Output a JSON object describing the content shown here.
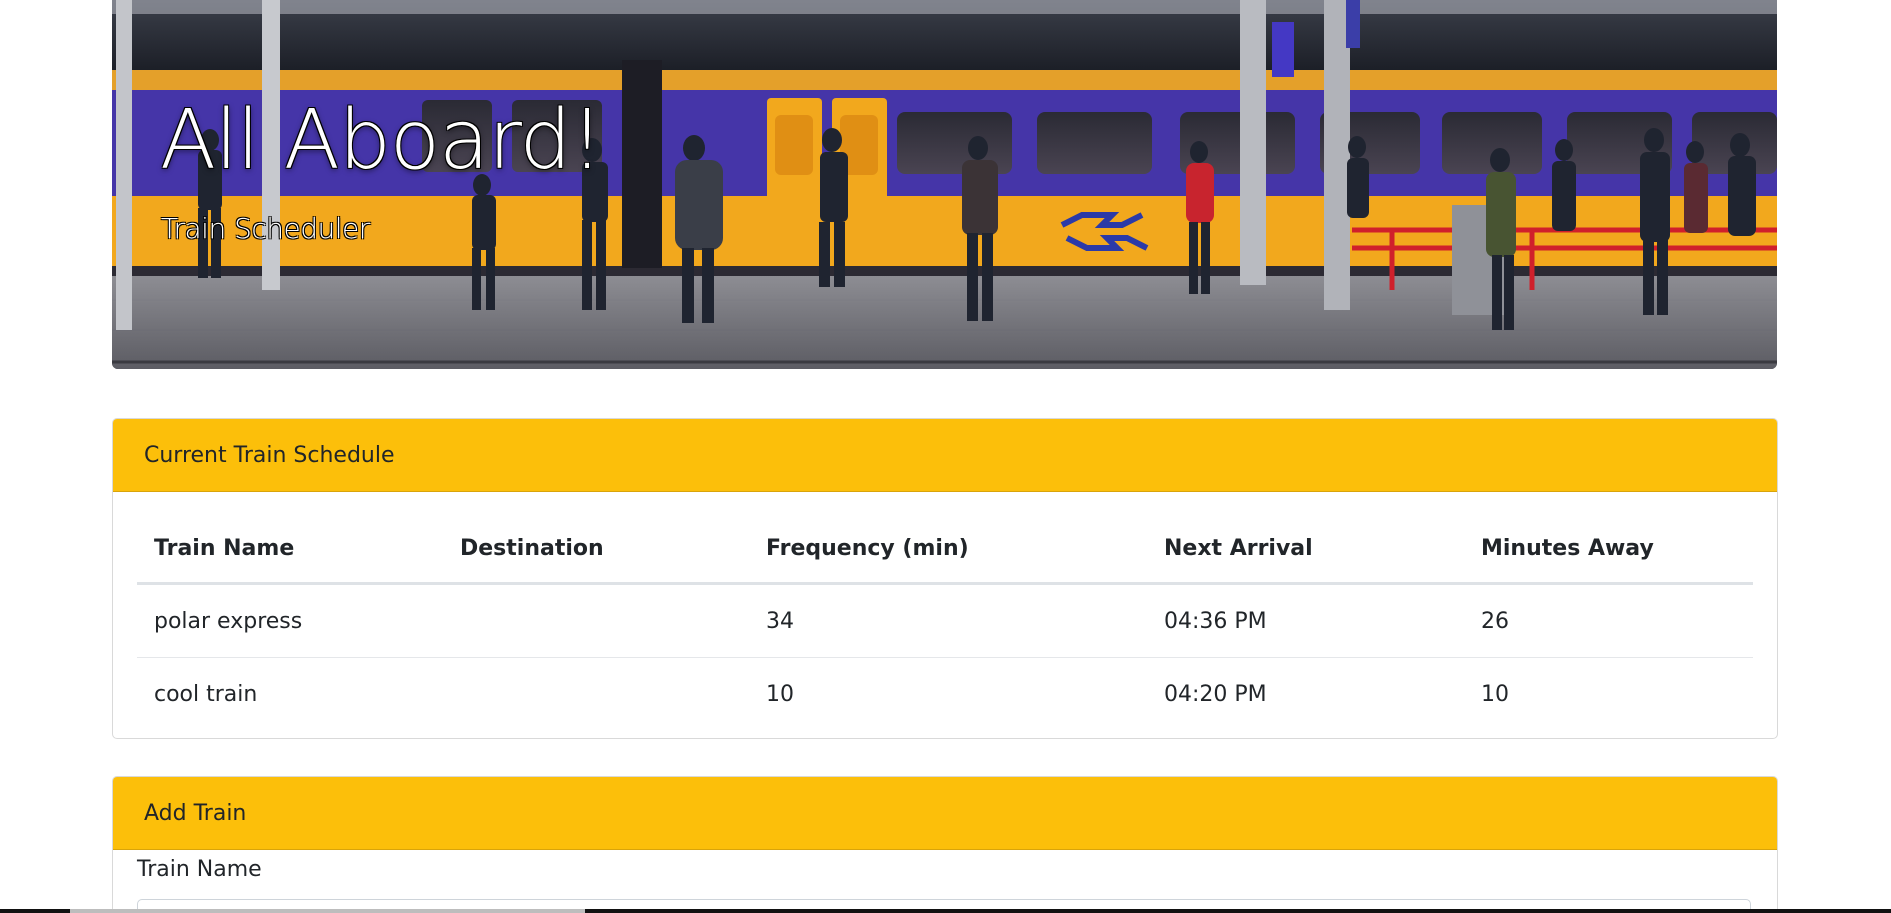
{
  "hero": {
    "title": "All Aboard!",
    "subtitle": "Train Scheduler"
  },
  "schedule": {
    "header": "Current Train Schedule",
    "columns": [
      "Train Name",
      "Destination",
      "Frequency (min)",
      "Next Arrival",
      "Minutes Away"
    ],
    "rows": [
      {
        "name": "polar express",
        "destination": "",
        "frequency": "34",
        "next_arrival": "04:36 PM",
        "minutes_away": "26"
      },
      {
        "name": "cool train",
        "destination": "",
        "frequency": "10",
        "next_arrival": "04:20 PM",
        "minutes_away": "10"
      }
    ]
  },
  "add_train": {
    "header": "Add Train",
    "train_name_label": "Train Name",
    "train_name_value": ""
  },
  "colors": {
    "card_header": "#fcbf0a",
    "train_body": "#4535a8",
    "train_stripe": "#f2a81d"
  }
}
